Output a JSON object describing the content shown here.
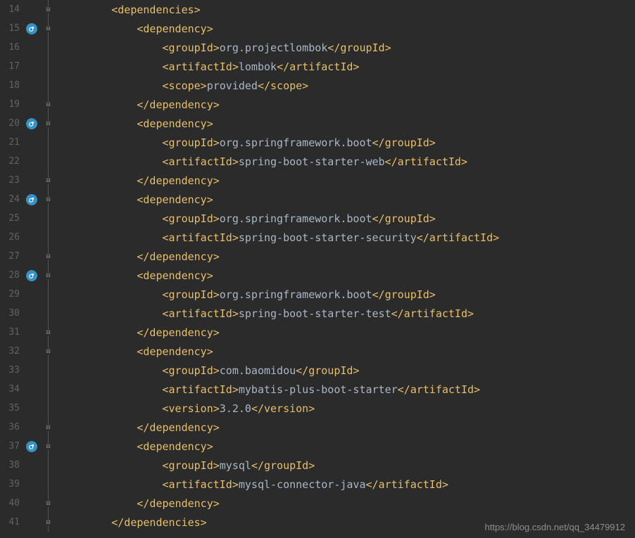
{
  "watermark": "https://blog.csdn.net/qq_34479912",
  "lines": [
    {
      "num": 14,
      "icon": false,
      "fold": "open",
      "indent": 2,
      "tokens": [
        {
          "t": "tag",
          "v": "<dependencies>"
        }
      ]
    },
    {
      "num": 15,
      "icon": true,
      "fold": "open",
      "indent": 3,
      "tokens": [
        {
          "t": "tag",
          "v": "<dependency>"
        }
      ]
    },
    {
      "num": 16,
      "icon": false,
      "fold": "mid",
      "indent": 4,
      "tokens": [
        {
          "t": "tag",
          "v": "<groupId>"
        },
        {
          "t": "text",
          "v": "org.projectlombok"
        },
        {
          "t": "tag",
          "v": "</groupId>"
        }
      ]
    },
    {
      "num": 17,
      "icon": false,
      "fold": "mid",
      "indent": 4,
      "tokens": [
        {
          "t": "tag",
          "v": "<artifactId>"
        },
        {
          "t": "text",
          "v": "lombok"
        },
        {
          "t": "tag",
          "v": "</artifactId>"
        }
      ]
    },
    {
      "num": 18,
      "icon": false,
      "fold": "mid",
      "indent": 4,
      "tokens": [
        {
          "t": "tag",
          "v": "<scope>"
        },
        {
          "t": "text",
          "v": "provided"
        },
        {
          "t": "tag",
          "v": "</scope>"
        }
      ]
    },
    {
      "num": 19,
      "icon": false,
      "fold": "close",
      "indent": 3,
      "tokens": [
        {
          "t": "tag",
          "v": "</dependency>"
        }
      ]
    },
    {
      "num": 20,
      "icon": true,
      "fold": "open",
      "indent": 3,
      "tokens": [
        {
          "t": "tag",
          "v": "<dependency>"
        }
      ]
    },
    {
      "num": 21,
      "icon": false,
      "fold": "mid",
      "indent": 4,
      "tokens": [
        {
          "t": "tag",
          "v": "<groupId>"
        },
        {
          "t": "text",
          "v": "org.springframework.boot"
        },
        {
          "t": "tag",
          "v": "</groupId>"
        }
      ]
    },
    {
      "num": 22,
      "icon": false,
      "fold": "mid",
      "indent": 4,
      "tokens": [
        {
          "t": "tag",
          "v": "<artifactId>"
        },
        {
          "t": "text",
          "v": "spring-boot-starter-web"
        },
        {
          "t": "tag",
          "v": "</artifactId>"
        }
      ]
    },
    {
      "num": 23,
      "icon": false,
      "fold": "close",
      "indent": 3,
      "tokens": [
        {
          "t": "tag",
          "v": "</dependency>"
        }
      ]
    },
    {
      "num": 24,
      "icon": true,
      "fold": "open",
      "indent": 3,
      "tokens": [
        {
          "t": "tag",
          "v": "<dependency>"
        }
      ]
    },
    {
      "num": 25,
      "icon": false,
      "fold": "mid",
      "indent": 4,
      "tokens": [
        {
          "t": "tag",
          "v": "<groupId>"
        },
        {
          "t": "text",
          "v": "org.springframework.boot"
        },
        {
          "t": "tag",
          "v": "</groupId>"
        }
      ]
    },
    {
      "num": 26,
      "icon": false,
      "fold": "mid",
      "indent": 4,
      "tokens": [
        {
          "t": "tag",
          "v": "<artifactId>"
        },
        {
          "t": "text",
          "v": "spring-boot-starter-security"
        },
        {
          "t": "tag",
          "v": "</artifactId>"
        }
      ]
    },
    {
      "num": 27,
      "icon": false,
      "fold": "close",
      "indent": 3,
      "tokens": [
        {
          "t": "tag",
          "v": "</dependency>"
        }
      ]
    },
    {
      "num": 28,
      "icon": true,
      "fold": "open",
      "indent": 3,
      "tokens": [
        {
          "t": "tag",
          "v": "<dependency>"
        }
      ]
    },
    {
      "num": 29,
      "icon": false,
      "fold": "mid",
      "indent": 4,
      "tokens": [
        {
          "t": "tag",
          "v": "<groupId>"
        },
        {
          "t": "text",
          "v": "org.springframework.boot"
        },
        {
          "t": "tag",
          "v": "</groupId>"
        }
      ]
    },
    {
      "num": 30,
      "icon": false,
      "fold": "mid",
      "indent": 4,
      "tokens": [
        {
          "t": "tag",
          "v": "<artifactId>"
        },
        {
          "t": "text",
          "v": "spring-boot-starter-test"
        },
        {
          "t": "tag",
          "v": "</artifactId>"
        }
      ]
    },
    {
      "num": 31,
      "icon": false,
      "fold": "close",
      "indent": 3,
      "tokens": [
        {
          "t": "tag",
          "v": "</dependency>"
        }
      ]
    },
    {
      "num": 32,
      "icon": false,
      "fold": "open",
      "indent": 3,
      "tokens": [
        {
          "t": "tag",
          "v": "<dependency>"
        }
      ]
    },
    {
      "num": 33,
      "icon": false,
      "fold": "mid",
      "indent": 4,
      "tokens": [
        {
          "t": "tag",
          "v": "<groupId>"
        },
        {
          "t": "text",
          "v": "com.baomidou"
        },
        {
          "t": "tag",
          "v": "</groupId>"
        }
      ]
    },
    {
      "num": 34,
      "icon": false,
      "fold": "mid",
      "indent": 4,
      "tokens": [
        {
          "t": "tag",
          "v": "<artifactId>"
        },
        {
          "t": "text",
          "v": "mybatis-plus-boot-starter"
        },
        {
          "t": "tag",
          "v": "</artifactId>"
        }
      ]
    },
    {
      "num": 35,
      "icon": false,
      "fold": "mid",
      "indent": 4,
      "tokens": [
        {
          "t": "tag",
          "v": "<version>"
        },
        {
          "t": "text",
          "v": "3.2.0"
        },
        {
          "t": "tag",
          "v": "</version>"
        }
      ]
    },
    {
      "num": 36,
      "icon": false,
      "fold": "close",
      "indent": 3,
      "tokens": [
        {
          "t": "tag",
          "v": "</dependency>"
        }
      ]
    },
    {
      "num": 37,
      "icon": true,
      "fold": "open",
      "indent": 3,
      "tokens": [
        {
          "t": "tag",
          "v": "<dependency>"
        }
      ]
    },
    {
      "num": 38,
      "icon": false,
      "fold": "mid",
      "indent": 4,
      "tokens": [
        {
          "t": "tag",
          "v": "<groupId>"
        },
        {
          "t": "text",
          "v": "mysql"
        },
        {
          "t": "tag",
          "v": "</groupId>"
        }
      ]
    },
    {
      "num": 39,
      "icon": false,
      "fold": "mid",
      "indent": 4,
      "tokens": [
        {
          "t": "tag",
          "v": "<artifactId>"
        },
        {
          "t": "text",
          "v": "mysql-connector-java"
        },
        {
          "t": "tag",
          "v": "</artifactId>"
        }
      ]
    },
    {
      "num": 40,
      "icon": false,
      "fold": "close",
      "indent": 3,
      "tokens": [
        {
          "t": "tag",
          "v": "</dependency>"
        }
      ]
    },
    {
      "num": 41,
      "icon": false,
      "fold": "close",
      "indent": 2,
      "tokens": [
        {
          "t": "tag",
          "v": "</dependencies>"
        }
      ]
    }
  ]
}
